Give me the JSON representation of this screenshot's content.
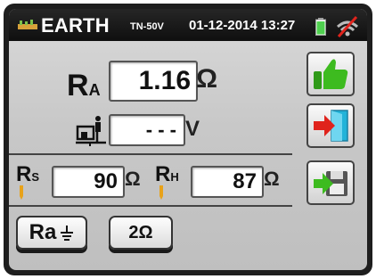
{
  "header": {
    "title": "EARTH",
    "subtitle": "TN-50V",
    "datetime": "01-12-2014 13:27"
  },
  "ra": {
    "label": "R",
    "label_sub": "A",
    "value": "1.16",
    "unit": "Ω"
  },
  "touch_voltage": {
    "value": "- - -",
    "unit": "V"
  },
  "rs": {
    "label": "R",
    "label_sub": "S",
    "value": "90",
    "unit": "Ω"
  },
  "rh": {
    "label": "R",
    "label_sub": "H",
    "value": "87",
    "unit": "Ω"
  },
  "buttons": {
    "mode_label": "Ra",
    "range_label": "2Ω"
  },
  "icons": {
    "ok": "thumbs-up-icon",
    "exit": "exit-door-icon",
    "save": "save-icon",
    "battery": "battery-icon",
    "signal": "no-signal-icon",
    "probe": "test-probe-icon",
    "ground": "earth-ground-icon"
  },
  "colors": {
    "accent_green": "#3dbb1f",
    "exit_red": "#e0231c",
    "door_cyan": "#22b3d9",
    "battery_green": "#4fd04f"
  }
}
